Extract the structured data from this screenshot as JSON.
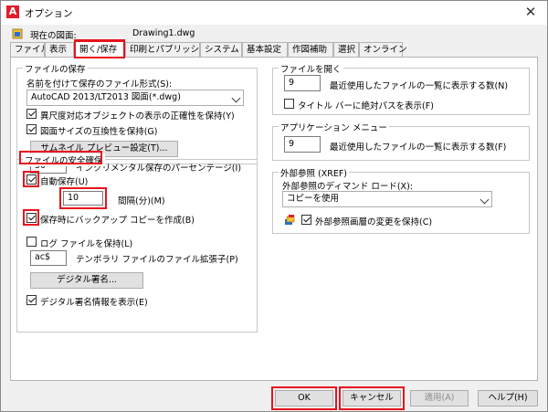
{
  "window": {
    "title": "オプション",
    "close_glyph": "✕"
  },
  "current_drawing": {
    "label": "現在の図面:",
    "value": "Drawing1.dwg"
  },
  "tabs": [
    {
      "label": "ファイル"
    },
    {
      "label": "表示"
    },
    {
      "label": "開く/保存"
    },
    {
      "label": "印刷とパブリッシュ"
    },
    {
      "label": "システム"
    },
    {
      "label": "基本設定"
    },
    {
      "label": "作図補助"
    },
    {
      "label": "選択"
    },
    {
      "label": "オンライン"
    }
  ],
  "save": {
    "title": "ファイルの保存",
    "format_label": "名前を付けて保存のファイル形式(S):",
    "format_value": "AutoCAD 2013/LT2013 図面(*.dwg)",
    "keep_visual_fidelity": "異尺度対応オブジェクトの表示の正確性を保持(Y)",
    "keep_size_compat": "図面サイズの互換性を保持(G)",
    "thumbnail_button": "サムネイル プレビュー設定(T)...",
    "incremental_value": "50",
    "incremental_label": "インクリメンタル保存のパーセンテージ(I)"
  },
  "safety": {
    "title": "ファイルの安全確保",
    "autosave_label": "自動保存(U)",
    "interval_value": "10",
    "interval_label": "間隔(分)(M)",
    "backup_label": "保存時にバックアップ コピーを作成(B)",
    "log_label": "ログ ファイルを保持(L)",
    "temp_ext_value": "ac$",
    "temp_ext_label": "テンポラリ ファイルのファイル拡張子(P)",
    "digsig_button": "デジタル署名...",
    "digsig_info_label": "デジタル署名情報を表示(E)"
  },
  "open": {
    "title": "ファイルを開く",
    "recent_value": "9",
    "recent_label": "最近使用したファイルの一覧に表示する数(N)",
    "fullpath_label": "タイトル バーに絶対パスを表示(F)"
  },
  "appmenu": {
    "title": "アプリケーション メニュー",
    "recent_value": "9",
    "recent_label": "最近使用したファイルの一覧に表示する数(F)"
  },
  "xref": {
    "title": "外部参照 (XREF)",
    "demand_label": "外部参照のディマンド ロード(X):",
    "demand_value": "コピーを使用",
    "retain_label": "外部参照画層の変更を保持(C)"
  },
  "buttons": {
    "ok": "OK",
    "cancel": "キャンセル",
    "apply": "適用(A)",
    "help": "ヘルプ(H)"
  },
  "colors": {
    "highlight": "#e8121e",
    "brand": "#e01d2b"
  }
}
